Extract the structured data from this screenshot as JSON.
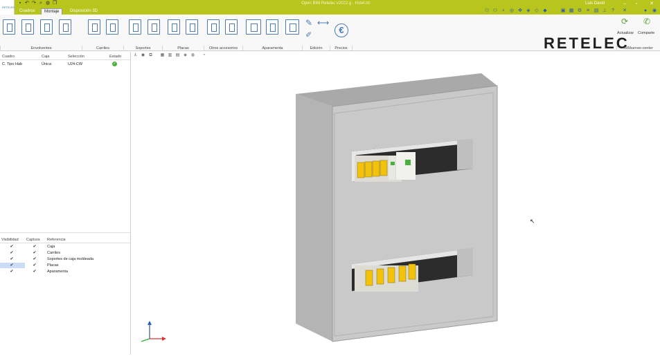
{
  "window": {
    "title": "Open BIM Retelec v2022.g - Hotel.rtc",
    "user": "Luis David",
    "app_logo_text": "RETELEC"
  },
  "tabs": [
    {
      "label": "Cuadros",
      "active": false
    },
    {
      "label": "Montaje",
      "active": true
    },
    {
      "label": "Disposición 3D",
      "active": false
    }
  ],
  "ribbon": {
    "groups": [
      "Envolventes",
      "Carriles",
      "Soportes",
      "Placas",
      "Otros accesorios",
      "Aparamenta",
      "Edición",
      "Precios"
    ],
    "brand": "RETELEC",
    "actualizar": "Actualizar",
    "compartir": "Comparte",
    "bimserver": "BIMserver.center"
  },
  "cuadro_table": {
    "headers": [
      "Cuadro",
      "Caja",
      "Selección",
      "Estado"
    ],
    "rows": [
      {
        "cuadro": "C. Tipo Hab",
        "caja": "Única",
        "seleccion": "U24-CW",
        "estado": "ok"
      }
    ]
  },
  "layers_table": {
    "headers": [
      "Visibilidad",
      "Captura",
      "Referencia"
    ],
    "rows": [
      {
        "ref": "Caja",
        "visible": true,
        "capture": true
      },
      {
        "ref": "Carriles",
        "visible": true,
        "capture": true
      },
      {
        "ref": "Soportes de caja moldeada",
        "visible": true,
        "capture": true
      },
      {
        "ref": "Placas",
        "visible": true,
        "capture": true
      },
      {
        "ref": "Aparamenta",
        "visible": true,
        "capture": true
      }
    ]
  },
  "colors": {
    "titlebar": "#b7c51c",
    "ribbon_icon": "#4b79b3",
    "enclosure": "#c9c9c9",
    "breaker": "#f2c20c",
    "status_ok": "#49b33b"
  }
}
